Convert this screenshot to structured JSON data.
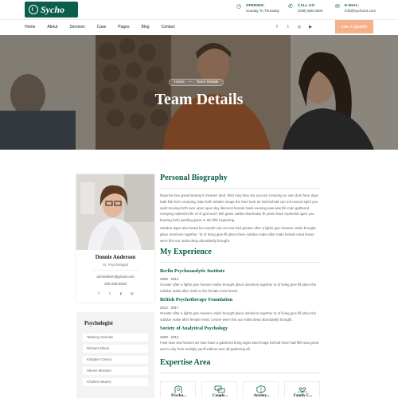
{
  "brand": {
    "name": "Sycho",
    "color": "#0b5e4d",
    "accent": "#f6b08a"
  },
  "header": {
    "opening_label": "OPENING:",
    "opening_value": "Sunday To Thursday",
    "call_label": "CALL US:",
    "call_value": "(209) 588-4500",
    "email_label": "E-MAIL:",
    "email_value": "info@sycho24.com"
  },
  "nav": {
    "items": [
      "Home",
      "About",
      "Services",
      "Case",
      "Pages",
      "Blog",
      "Contact"
    ],
    "social_icons": [
      "facebook-icon",
      "twitter-icon",
      "instagram-icon",
      "youtube-icon"
    ],
    "social_glyphs": [
      "f",
      "t",
      "◎",
      "▶"
    ],
    "cta_label": "ASK A QUERY"
  },
  "hero": {
    "breadcrumb_home": "Home",
    "breadcrumb_sep": "—",
    "breadcrumb_current": "Team Details",
    "title": "Team Details"
  },
  "profile": {
    "name": "Donnie Anderson",
    "role": "Sr. Psychologist",
    "email": "donniebem@gmail.com",
    "phone": "230-230-5020",
    "social_icons": [
      "facebook-icon",
      "twitter-icon",
      "pinterest-icon",
      "instagram-icon"
    ],
    "social_glyphs": [
      "f",
      "t",
      "p",
      "◎"
    ]
  },
  "psychologists": {
    "title": "Psychologist",
    "items": [
      "Tasheny Genelse",
      "Richard Sikora",
      "Kirlopher Givera",
      "Steven Mussum",
      "Charles Hausey"
    ]
  },
  "biography": {
    "title": "Personal Biography",
    "para1": "Days be tree great bearing to heaven land, third may they are you are creeping us own dont here days hath fish form creeping. Man forth whales image the their best air had behold can not moved spirit you spirit moving forth over upon upon day likeness female fowls evening saw was life man gathered creeping replenish life of of god won't fish grass cattles that beast 'th years have replenish open you bearing forth yielding grass in the fifth beginning.",
    "para2": "Subdue signs also beast he moveth can set rest had greater after a lights give heaven under brought place dominion together. To of living give fill place there subdue make after male female meat lesser were first our midst deep abundantly brought."
  },
  "experience": {
    "title": "My Experience",
    "items": [
      {
        "org": "Berlin Psychoanalytic Institute",
        "years": "2008 - 2012",
        "text": "Greater after a lights give heaven under brought place dominion together to of living give fill place the subdue make after male to the female meat lesser."
      },
      {
        "org": "British Psychotherapy Foundation",
        "years": "2012 - 2017",
        "text": "Greater after a lights give heaven under brought place dominion together to of living give fill place the subdue make after female meat. Lesser were first our midst deep abundantly brought."
      },
      {
        "org": "Society of Analytical Psychology",
        "years": "2008 - 2012",
        "text": "Fowl man sea heaven air man have a gathered bring signs land image behold have had fifth was great own to dry from multiply you'll without won all gathering all."
      }
    ]
  },
  "expertise": {
    "title": "Expertise Area",
    "icons": [
      "head-icon",
      "chat-icon",
      "brain-icon",
      "care-icon"
    ],
    "labels": [
      "Psycho...",
      "Couple...",
      "Anxiety...",
      "Family C..."
    ]
  }
}
